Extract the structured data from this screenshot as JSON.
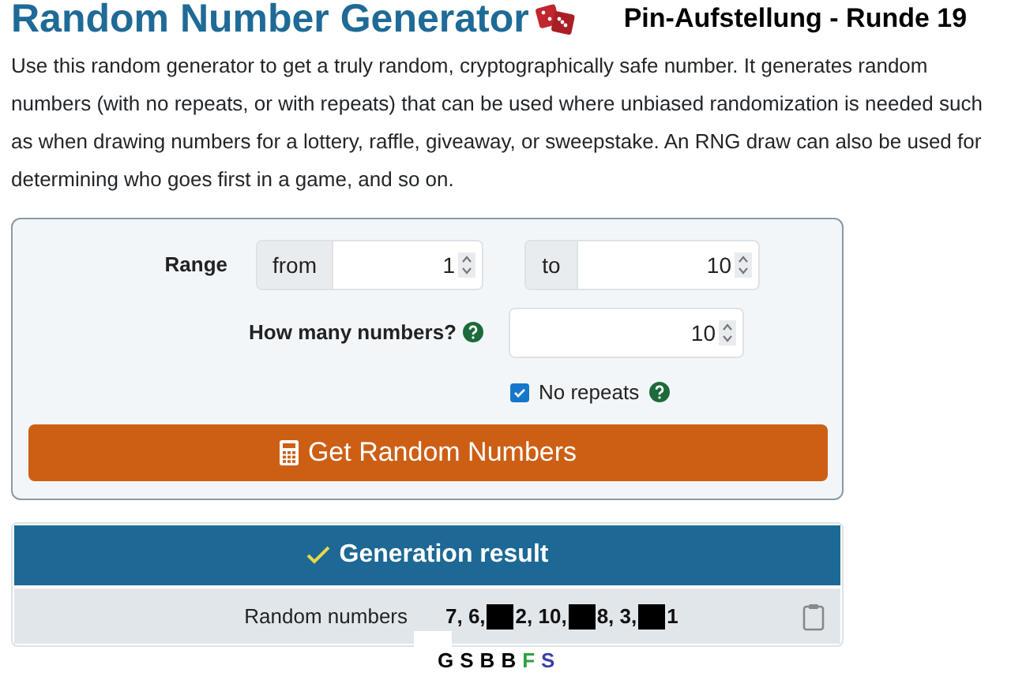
{
  "header": {
    "title": "Random Number Generator",
    "overlay_title": "Pin-Aufstellung - Runde 19"
  },
  "intro": "Use this random generator to get a truly random, cryptographically safe number. It generates random numbers (with no repeats, or with repeats) that can be used where unbiased randomization is needed such as when drawing numbers for a lottery, raffle, giveaway, or sweepstake. An RNG draw can also be used for determining who goes first in a game, and so on.",
  "form": {
    "range_label": "Range",
    "from_addon": "from",
    "from_value": "1",
    "to_addon": "to",
    "to_value": "10",
    "count_label": "How many numbers?",
    "count_value": "10",
    "no_repeats": {
      "label": "No repeats",
      "checked": true
    },
    "submit": "Get Random Numbers"
  },
  "result": {
    "title": "Generation result",
    "label": "Random numbers",
    "segments": [
      {
        "kind": "text",
        "text": "7, 6,"
      },
      {
        "kind": "redaction"
      },
      {
        "kind": "text",
        "text": "2, 10,"
      },
      {
        "kind": "redaction"
      },
      {
        "kind": "text",
        "text": "8, 3,"
      },
      {
        "kind": "redaction"
      },
      {
        "kind": "text",
        "text": "1"
      }
    ]
  },
  "letters": [
    {
      "text": "G",
      "color": "#000000"
    },
    {
      "text": "S",
      "color": "#000000"
    },
    {
      "text": "B",
      "color": "#000000"
    },
    {
      "text": "B",
      "color": "#000000"
    },
    {
      "text": "F",
      "color": "#2ea043"
    },
    {
      "text": "S",
      "color": "#3b3fa8"
    }
  ]
}
